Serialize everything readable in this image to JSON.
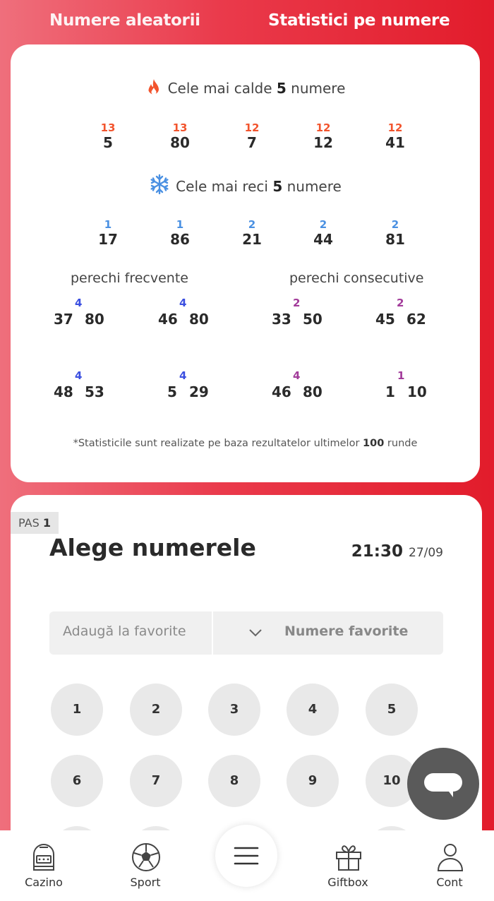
{
  "tabs": {
    "random": "Numere aleatorii",
    "stats": "Statistici pe numere"
  },
  "hot": {
    "title_prefix": "Cele mai calde",
    "title_count": "5",
    "title_suffix": "numere",
    "items": [
      {
        "count": "13",
        "number": "5"
      },
      {
        "count": "13",
        "number": "80"
      },
      {
        "count": "12",
        "number": "7"
      },
      {
        "count": "12",
        "number": "12"
      },
      {
        "count": "12",
        "number": "41"
      }
    ]
  },
  "cold": {
    "title_prefix": "Cele mai reci",
    "title_count": "5",
    "title_suffix": "numere",
    "items": [
      {
        "count": "1",
        "number": "17"
      },
      {
        "count": "1",
        "number": "86"
      },
      {
        "count": "2",
        "number": "21"
      },
      {
        "count": "2",
        "number": "44"
      },
      {
        "count": "2",
        "number": "81"
      }
    ]
  },
  "pairs_frequent": {
    "title": "perechi frecvente",
    "items": [
      {
        "a": "37",
        "b": "80",
        "count": "4"
      },
      {
        "a": "46",
        "b": "80",
        "count": "4"
      },
      {
        "a": "48",
        "b": "53",
        "count": "4"
      },
      {
        "a": "5",
        "b": "29",
        "count": "4"
      }
    ]
  },
  "pairs_consecutive": {
    "title": "perechi consecutive",
    "items": [
      {
        "a": "33",
        "b": "50",
        "count": "2"
      },
      {
        "a": "45",
        "b": "62",
        "count": "2"
      },
      {
        "a": "46",
        "b": "80",
        "count": "4"
      },
      {
        "a": "1",
        "b": "10",
        "count": "1"
      }
    ]
  },
  "footnote": {
    "prefix": "*Statisticile sunt realizate pe baza rezultatelor ultimelor",
    "count": "100",
    "suffix": "runde"
  },
  "step": {
    "label": "PAS",
    "number": "1"
  },
  "picker": {
    "title": "Alege numerele",
    "time": "21:30",
    "date": "27/09",
    "fav_add_placeholder": "Adaugă la favorite",
    "fav_select_label": "Numere favorite",
    "balls": [
      "1",
      "2",
      "3",
      "4",
      "5",
      "6",
      "7",
      "8",
      "9",
      "10"
    ]
  },
  "nav": {
    "casino": "Cazino",
    "sport": "Sport",
    "giftbox": "Giftbox",
    "account": "Cont"
  },
  "icons": {
    "hot": "fire-icon",
    "cold": "snowflake-icon",
    "chevron": "chevron-down-icon",
    "chat": "chat-icon",
    "menu": "menu-icon"
  }
}
